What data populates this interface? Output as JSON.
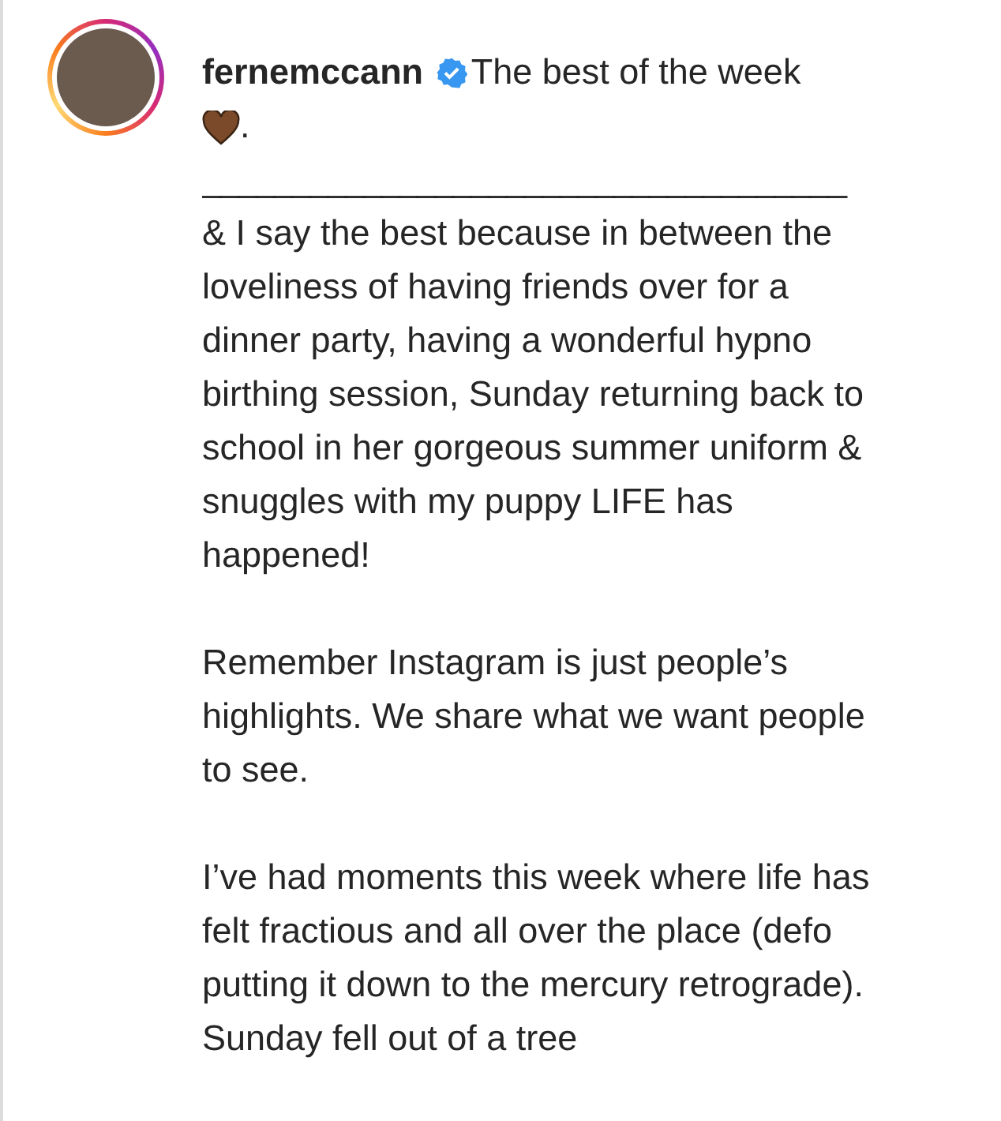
{
  "post": {
    "username": "fernemccann",
    "verified": true,
    "caption_title": "The best of the week",
    "caption_end": ".",
    "divider": "____________________________________",
    "paragraphs": [
      "& I say the best because in between the loveliness of having friends over for a dinner party, having a wonderful hypno birthing session, Sunday returning back to school in her gorgeous summer uniform & snuggles with my puppy LIFE has happened!",
      "Remember Instagram is just people’s highlights. We share what we want people to see.",
      "I’ve had moments this week where life has felt fractious and all over the place (defo putting it down to the mercury retrograde). Sunday fell out of a tree"
    ]
  }
}
